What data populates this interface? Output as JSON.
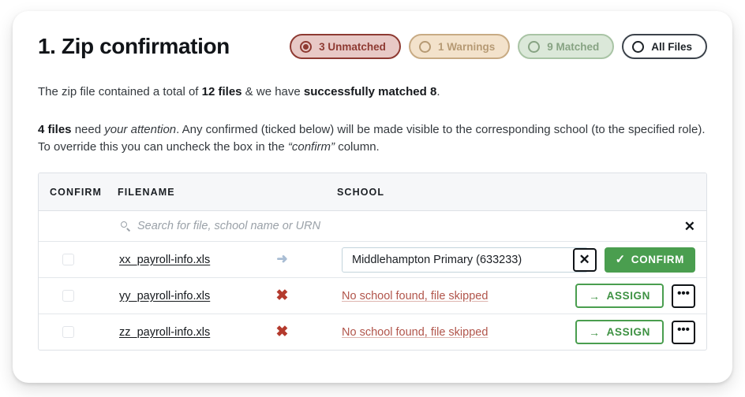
{
  "page": {
    "title": "1. Zip confirmation"
  },
  "filters": [
    {
      "label": "3 Unmatched",
      "state": "selected",
      "style": "unmatched"
    },
    {
      "label": "1 Warnings",
      "state": "unselected",
      "style": "warnings"
    },
    {
      "label": "9 Matched",
      "state": "unselected",
      "style": "matched"
    },
    {
      "label": "All Files",
      "state": "unselected",
      "style": "all"
    }
  ],
  "intro": {
    "line1_a": "The zip file contained a total of ",
    "line1_b": "12 files",
    "line1_c": " & we have ",
    "line1_d": "successfully matched 8",
    "line1_e": ".",
    "line2_a": "4 files",
    "line2_b": " need ",
    "line2_c": "your attention",
    "line2_d": ". Any confirmed (ticked below) will be made visible to the corresponding school (to the specified role). To override this you can uncheck the box in the ",
    "line2_e": "“confirm”",
    "line2_f": " column."
  },
  "table": {
    "headers": {
      "confirm": "CONFIRM",
      "filename": "FILENAME",
      "school": "SCHOOL",
      "actions": ""
    },
    "search": {
      "placeholder": "Search for file, school name or URN",
      "value": "",
      "clear_label": "✕",
      "icon": "search-icon"
    },
    "rows": [
      {
        "filename": "xx_payroll-info.xls",
        "checked": false,
        "status_icon": "arrow-right-icon",
        "status_glyph": "➜",
        "school_value": "Middlehampton Primary (633233)",
        "school_caret": "▾",
        "type": "matched",
        "reject_label": "✕",
        "confirm_label": "CONFIRM",
        "confirm_tick": "✓"
      },
      {
        "filename": "yy_payroll-info.xls",
        "checked": false,
        "status_icon": "x-mark-icon",
        "status_glyph": "✖",
        "school_message": "No school found, file skipped",
        "type": "unmatched",
        "assign_label": "ASSIGN",
        "assign_arrow": "→",
        "more_label": "•••"
      },
      {
        "filename": "zz_payroll-info.xls",
        "checked": false,
        "status_icon": "x-mark-icon",
        "status_glyph": "✖",
        "school_message": "No school found, file skipped",
        "type": "unmatched",
        "assign_label": "ASSIGN",
        "assign_arrow": "→",
        "more_label": "•••"
      }
    ]
  },
  "colors": {
    "green": "#4a9e4f",
    "red": "#b43a2d",
    "unmatched_pill": "#8e3a32",
    "warning_pill": "#b69a74",
    "matched_pill": "#87a383"
  }
}
